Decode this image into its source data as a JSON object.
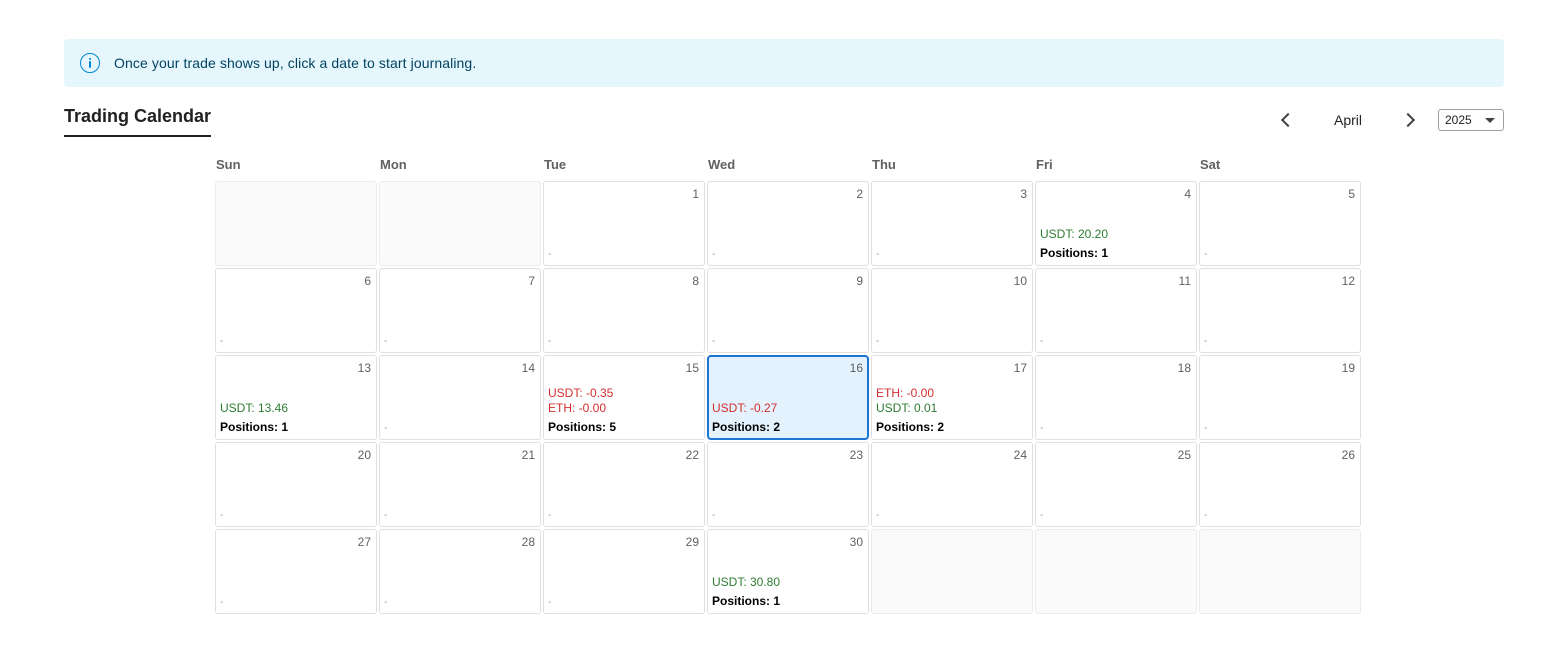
{
  "banner": {
    "message": "Once your trade shows up, click a date to start journaling."
  },
  "title": "Trading Calendar",
  "nav": {
    "month": "April",
    "year": "2025"
  },
  "weekdays": [
    "Sun",
    "Mon",
    "Tue",
    "Wed",
    "Thu",
    "Fri",
    "Sat"
  ],
  "colors": {
    "positive": "#2e7d32",
    "negative": "#d32f2f",
    "selected_bg": "#e3f2fd",
    "selected_border": "#1976d2",
    "banner_bg": "#e5f6fd"
  },
  "selected_day": 16,
  "leading_empty": 2,
  "trailing_empty": 3,
  "days": [
    {
      "day": 1,
      "entries": [],
      "positions": null,
      "placeholder": "-"
    },
    {
      "day": 2,
      "entries": [],
      "positions": null,
      "placeholder": "-"
    },
    {
      "day": 3,
      "entries": [],
      "positions": null,
      "placeholder": "-"
    },
    {
      "day": 4,
      "entries": [
        {
          "text": "USDT: 20.20",
          "sign": "pos"
        }
      ],
      "positions": "Positions: 1"
    },
    {
      "day": 5,
      "entries": [],
      "positions": null,
      "placeholder": "-"
    },
    {
      "day": 6,
      "entries": [],
      "positions": null,
      "placeholder": "-"
    },
    {
      "day": 7,
      "entries": [],
      "positions": null,
      "placeholder": "-"
    },
    {
      "day": 8,
      "entries": [],
      "positions": null,
      "placeholder": "-"
    },
    {
      "day": 9,
      "entries": [],
      "positions": null,
      "placeholder": "-"
    },
    {
      "day": 10,
      "entries": [],
      "positions": null,
      "placeholder": "-"
    },
    {
      "day": 11,
      "entries": [],
      "positions": null,
      "placeholder": "-"
    },
    {
      "day": 12,
      "entries": [],
      "positions": null,
      "placeholder": "-"
    },
    {
      "day": 13,
      "entries": [
        {
          "text": "USDT: 13.46",
          "sign": "pos"
        }
      ],
      "positions": "Positions: 1"
    },
    {
      "day": 14,
      "entries": [],
      "positions": null,
      "placeholder": "-"
    },
    {
      "day": 15,
      "entries": [
        {
          "text": "USDT: -0.35",
          "sign": "neg"
        },
        {
          "text": "ETH: -0.00",
          "sign": "neg"
        }
      ],
      "positions": "Positions: 5"
    },
    {
      "day": 16,
      "entries": [
        {
          "text": "USDT: -0.27",
          "sign": "neg"
        }
      ],
      "positions": "Positions: 2"
    },
    {
      "day": 17,
      "entries": [
        {
          "text": "ETH: -0.00",
          "sign": "neg"
        },
        {
          "text": "USDT: 0.01",
          "sign": "pos"
        }
      ],
      "positions": "Positions: 2"
    },
    {
      "day": 18,
      "entries": [],
      "positions": null,
      "placeholder": "-"
    },
    {
      "day": 19,
      "entries": [],
      "positions": null,
      "placeholder": "-"
    },
    {
      "day": 20,
      "entries": [],
      "positions": null,
      "placeholder": "-"
    },
    {
      "day": 21,
      "entries": [],
      "positions": null,
      "placeholder": "-"
    },
    {
      "day": 22,
      "entries": [],
      "positions": null,
      "placeholder": "-"
    },
    {
      "day": 23,
      "entries": [],
      "positions": null,
      "placeholder": "-"
    },
    {
      "day": 24,
      "entries": [],
      "positions": null,
      "placeholder": "-"
    },
    {
      "day": 25,
      "entries": [],
      "positions": null,
      "placeholder": "-"
    },
    {
      "day": 26,
      "entries": [],
      "positions": null,
      "placeholder": "-"
    },
    {
      "day": 27,
      "entries": [],
      "positions": null,
      "placeholder": "-"
    },
    {
      "day": 28,
      "entries": [],
      "positions": null,
      "placeholder": "-"
    },
    {
      "day": 29,
      "entries": [],
      "positions": null,
      "placeholder": "-"
    },
    {
      "day": 30,
      "entries": [
        {
          "text": "USDT: 30.80",
          "sign": "pos"
        }
      ],
      "positions": "Positions: 1"
    }
  ]
}
